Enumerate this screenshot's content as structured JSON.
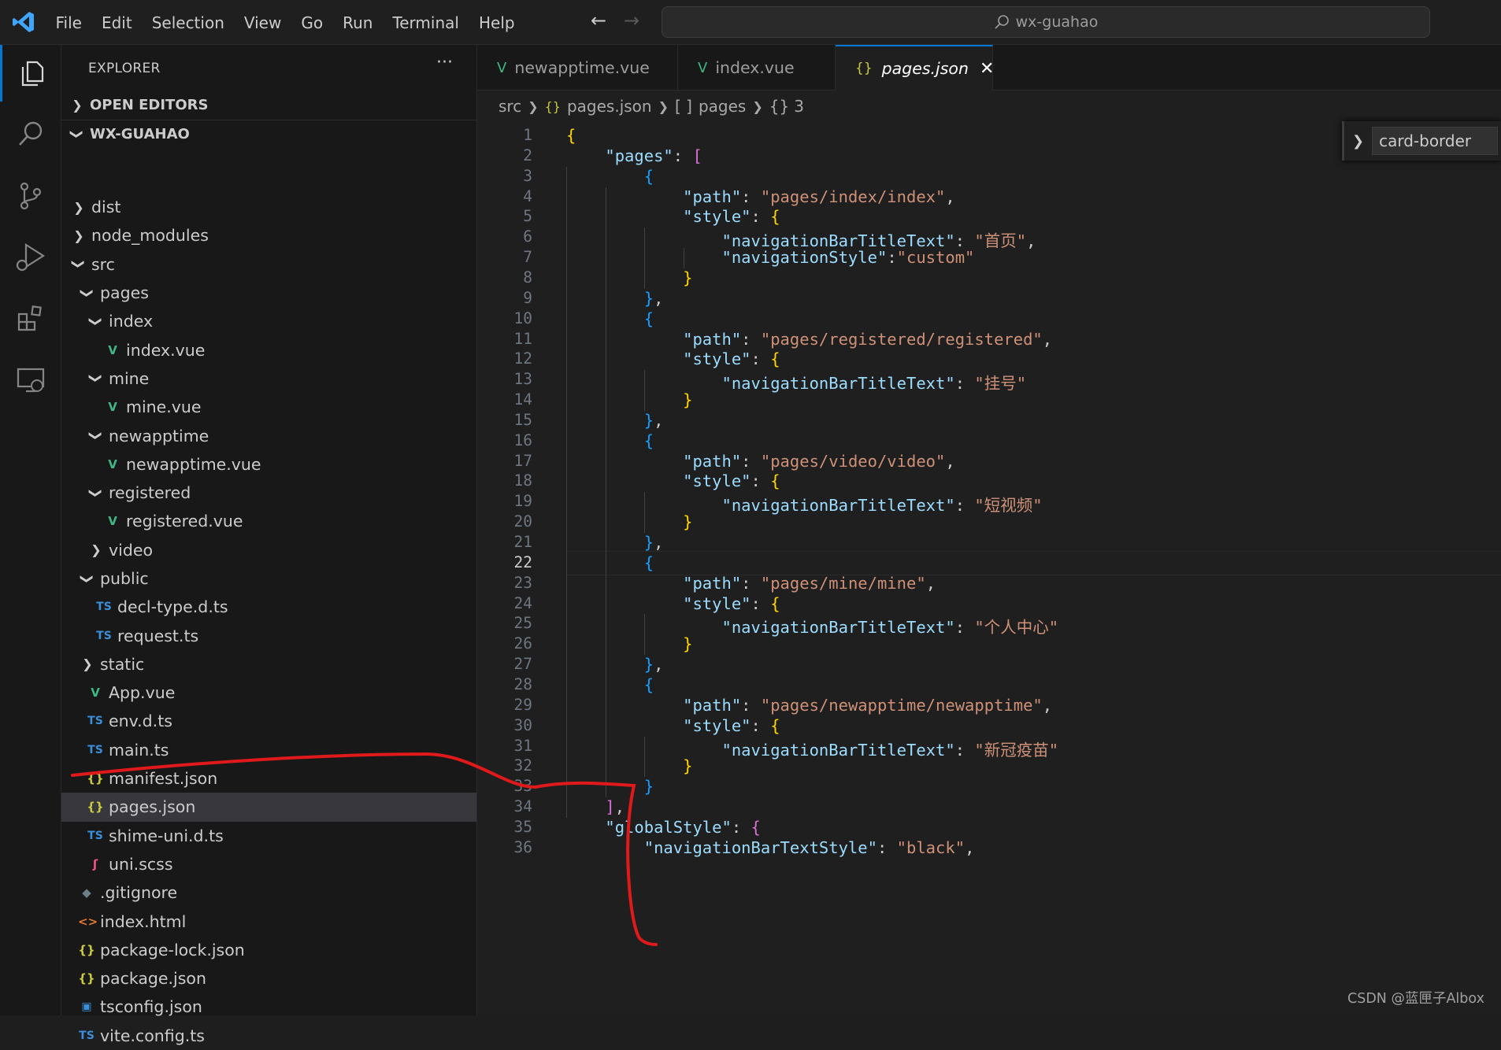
{
  "titlebar": {
    "menu": [
      "File",
      "Edit",
      "Selection",
      "View",
      "Go",
      "Run",
      "Terminal",
      "Help"
    ],
    "search_text": "wx-guahao"
  },
  "explorer": {
    "title": "EXPLORER",
    "more": "···",
    "open_editors": "OPEN EDITORS",
    "project": "WX-GUAHAO",
    "tree": [
      {
        "label": "dist",
        "depth": 0,
        "kind": "folder",
        "open": false
      },
      {
        "label": "node_modules",
        "depth": 0,
        "kind": "folder",
        "open": false
      },
      {
        "label": "src",
        "depth": 0,
        "kind": "folder",
        "open": true
      },
      {
        "label": "pages",
        "depth": 1,
        "kind": "folder",
        "open": true
      },
      {
        "label": "index",
        "depth": 2,
        "kind": "folder",
        "open": true
      },
      {
        "label": "index.vue",
        "depth": 3,
        "kind": "vue"
      },
      {
        "label": "mine",
        "depth": 2,
        "kind": "folder",
        "open": true
      },
      {
        "label": "mine.vue",
        "depth": 3,
        "kind": "vue"
      },
      {
        "label": "newapptime",
        "depth": 2,
        "kind": "folder",
        "open": true
      },
      {
        "label": "newapptime.vue",
        "depth": 3,
        "kind": "vue"
      },
      {
        "label": "registered",
        "depth": 2,
        "kind": "folder",
        "open": true
      },
      {
        "label": "registered.vue",
        "depth": 3,
        "kind": "vue"
      },
      {
        "label": "video",
        "depth": 2,
        "kind": "folder",
        "open": false
      },
      {
        "label": "public",
        "depth": 1,
        "kind": "folder",
        "open": true
      },
      {
        "label": "decl-type.d.ts",
        "depth": 2,
        "kind": "ts"
      },
      {
        "label": "request.ts",
        "depth": 2,
        "kind": "ts"
      },
      {
        "label": "static",
        "depth": 1,
        "kind": "folder",
        "open": false
      },
      {
        "label": "App.vue",
        "depth": 1,
        "kind": "vue"
      },
      {
        "label": "env.d.ts",
        "depth": 1,
        "kind": "ts"
      },
      {
        "label": "main.ts",
        "depth": 1,
        "kind": "ts"
      },
      {
        "label": "manifest.json",
        "depth": 1,
        "kind": "json"
      },
      {
        "label": "pages.json",
        "depth": 1,
        "kind": "json",
        "selected": true
      },
      {
        "label": "shime-uni.d.ts",
        "depth": 1,
        "kind": "ts"
      },
      {
        "label": "uni.scss",
        "depth": 1,
        "kind": "scss"
      },
      {
        "label": ".gitignore",
        "depth": 0,
        "kind": "git"
      },
      {
        "label": "index.html",
        "depth": 0,
        "kind": "html"
      },
      {
        "label": "package-lock.json",
        "depth": 0,
        "kind": "json"
      },
      {
        "label": "package.json",
        "depth": 0,
        "kind": "json"
      },
      {
        "label": "tsconfig.json",
        "depth": 0,
        "kind": "tsconfig"
      },
      {
        "label": "vite.config.ts",
        "depth": 0,
        "kind": "ts"
      }
    ]
  },
  "tabs": [
    {
      "label": "newapptime.vue",
      "kind": "vue",
      "active": false
    },
    {
      "label": "index.vue",
      "kind": "vue",
      "active": false
    },
    {
      "label": "pages.json",
      "kind": "json",
      "active": true
    }
  ],
  "breadcrumb": [
    "src",
    "pages.json",
    "pages",
    "3"
  ],
  "find_widget": {
    "value": "card-border"
  },
  "editor": {
    "current_line": 22,
    "lines": [
      "{",
      "    \"pages\": [",
      "        {",
      "            \"path\": \"pages/index/index\",",
      "            \"style\": {",
      "                \"navigationBarTitleText\": \"首页\",",
      "                \"navigationStyle\":\"custom\"",
      "            }",
      "        },",
      "        {",
      "            \"path\": \"pages/registered/registered\",",
      "            \"style\": {",
      "                \"navigationBarTitleText\": \"挂号\"",
      "            }",
      "        },",
      "        {",
      "            \"path\": \"pages/video/video\",",
      "            \"style\": {",
      "                \"navigationBarTitleText\": \"短视频\"",
      "            }",
      "        },",
      "        {",
      "            \"path\": \"pages/mine/mine\",",
      "            \"style\": {",
      "                \"navigationBarTitleText\": \"个人中心\"",
      "            }",
      "        },",
      "        {",
      "            \"path\": \"pages/newapptime/newapptime\",",
      "            \"style\": {",
      "                \"navigationBarTitleText\": \"新冠疫苗\"",
      "            }",
      "        }",
      "    ],",
      "    \"globalStyle\": {",
      "        \"navigationBarTextStyle\": \"black\","
    ]
  },
  "watermark": "CSDN @蓝匣子Albox",
  "colors": {
    "accent": "#0078d4",
    "annotation": "#e0191b"
  }
}
